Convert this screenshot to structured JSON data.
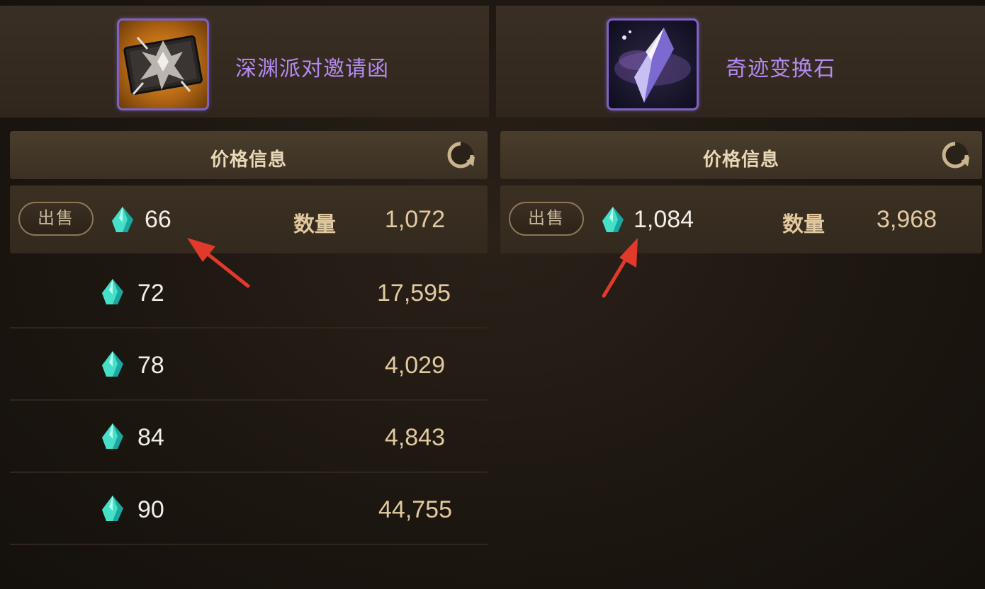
{
  "left_panel": {
    "item_name": "深渊派对邀请函",
    "item_icon": "abyss-party-invitation-icon",
    "price_info_title": "价格信息",
    "sell_label": "出售",
    "first_listing": {
      "price": "66",
      "qty_label": "数量",
      "qty": "1,072"
    },
    "listings": [
      {
        "price": "72",
        "qty": "17,595"
      },
      {
        "price": "78",
        "qty": "4,029"
      },
      {
        "price": "84",
        "qty": "4,843"
      },
      {
        "price": "90",
        "qty": "44,755"
      }
    ]
  },
  "right_panel": {
    "item_name": "奇迹变换石",
    "item_icon": "miracle-conversion-stone-icon",
    "price_info_title": "价格信息",
    "sell_label": "出售",
    "first_listing": {
      "price": "1,084",
      "qty_label": "数量",
      "qty": "3,968"
    }
  },
  "colors": {
    "item_name": "#b48af0",
    "quantity": "#e2c9a0",
    "annotation_arrow": "#e23a2a"
  }
}
